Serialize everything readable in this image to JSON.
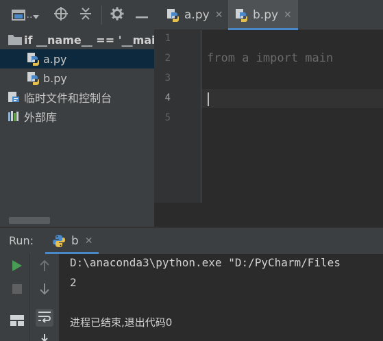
{
  "project": {
    "toolbar": {
      "view_mode_label": "..",
      "icons": [
        "project-view-icon",
        "dropdown-caret-icon",
        "locate-target-icon",
        "collapse-all-icon",
        "gear-icon",
        "hide-minus-icon"
      ]
    },
    "tree": [
      {
        "label": "if __name__ == '__main",
        "icon": "folder-icon",
        "root": true
      },
      {
        "label": "a.py",
        "icon": "python-file-icon",
        "selected": true
      },
      {
        "label": "b.py",
        "icon": "python-file-icon"
      },
      {
        "label": "临时文件和控制台",
        "icon": "scratches-icon"
      },
      {
        "label": "外部库",
        "icon": "external-libraries-icon"
      }
    ]
  },
  "editor": {
    "tabs": [
      {
        "label": "a.py",
        "active": false
      },
      {
        "label": "b.py",
        "active": true
      }
    ],
    "close_glyph": "✕",
    "line_numbers": [
      "1",
      "2",
      "3",
      "4",
      "5"
    ],
    "current_line": "4",
    "code": [
      "",
      "from a import main",
      "",
      "",
      ""
    ]
  },
  "run": {
    "title": "Run:",
    "tab_label": "b",
    "close_glyph": "✕",
    "console": [
      "D:\\anaconda3\\python.exe \"D:/PyCharm/Files",
      "2",
      "",
      "进程已结束,退出代码0"
    ],
    "colors": {
      "run_green": "#499c54",
      "accent_blue": "#4a88c7",
      "selection": "#0d293e"
    }
  }
}
